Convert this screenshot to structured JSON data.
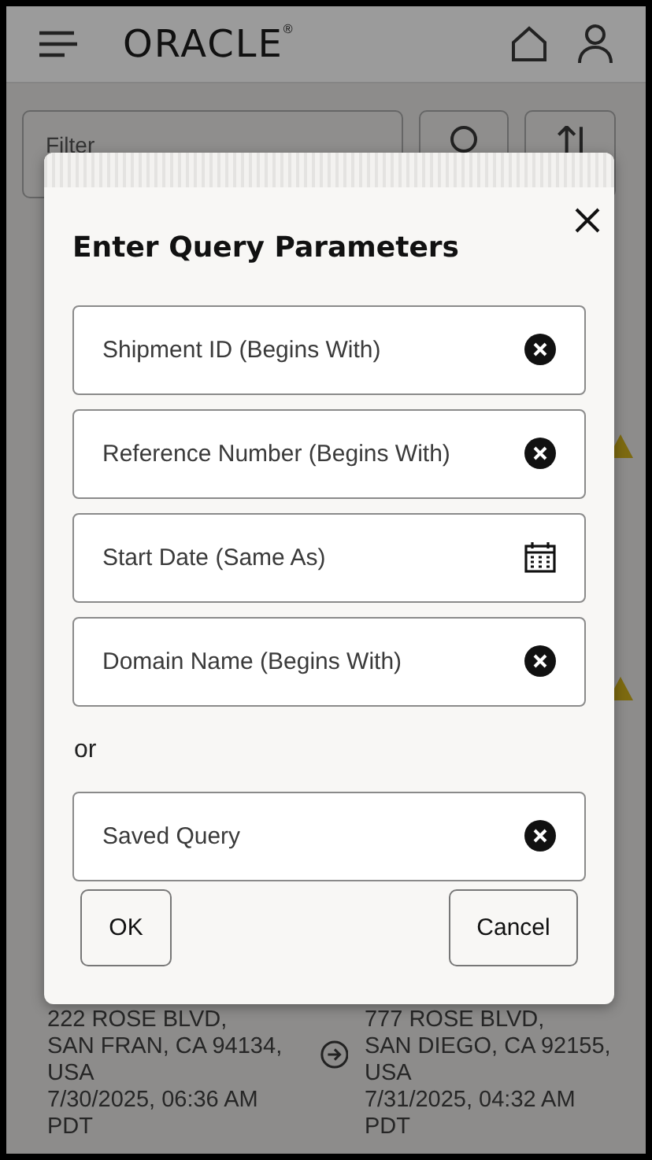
{
  "app_bar": {
    "logo": "ORACLE",
    "logo_mark": "®"
  },
  "toolbar": {
    "filter_placeholder": "Filter"
  },
  "shipment_card": {
    "origin": [
      "222 ROSE BLVD,",
      "SAN FRAN, CA 94134,",
      "USA",
      "7/30/2025, 06:36 AM",
      "PDT"
    ],
    "destination": [
      "777 ROSE BLVD,",
      "SAN DIEGO, CA 92155,",
      "USA",
      "7/31/2025, 04:32 AM",
      "PDT"
    ]
  },
  "dialog": {
    "title": "Enter Query Parameters",
    "fields": [
      {
        "placeholder": "Shipment ID (Begins With)",
        "kind": "clear"
      },
      {
        "placeholder": "Reference Number (Begins With)",
        "kind": "clear"
      },
      {
        "placeholder": "Start Date (Same As)",
        "kind": "date"
      },
      {
        "placeholder": "Domain Name (Begins With)",
        "kind": "clear"
      }
    ],
    "separator": "or",
    "saved_query": {
      "placeholder": "Saved Query",
      "kind": "clear"
    },
    "buttons": [
      "OK",
      "Cancel"
    ]
  }
}
